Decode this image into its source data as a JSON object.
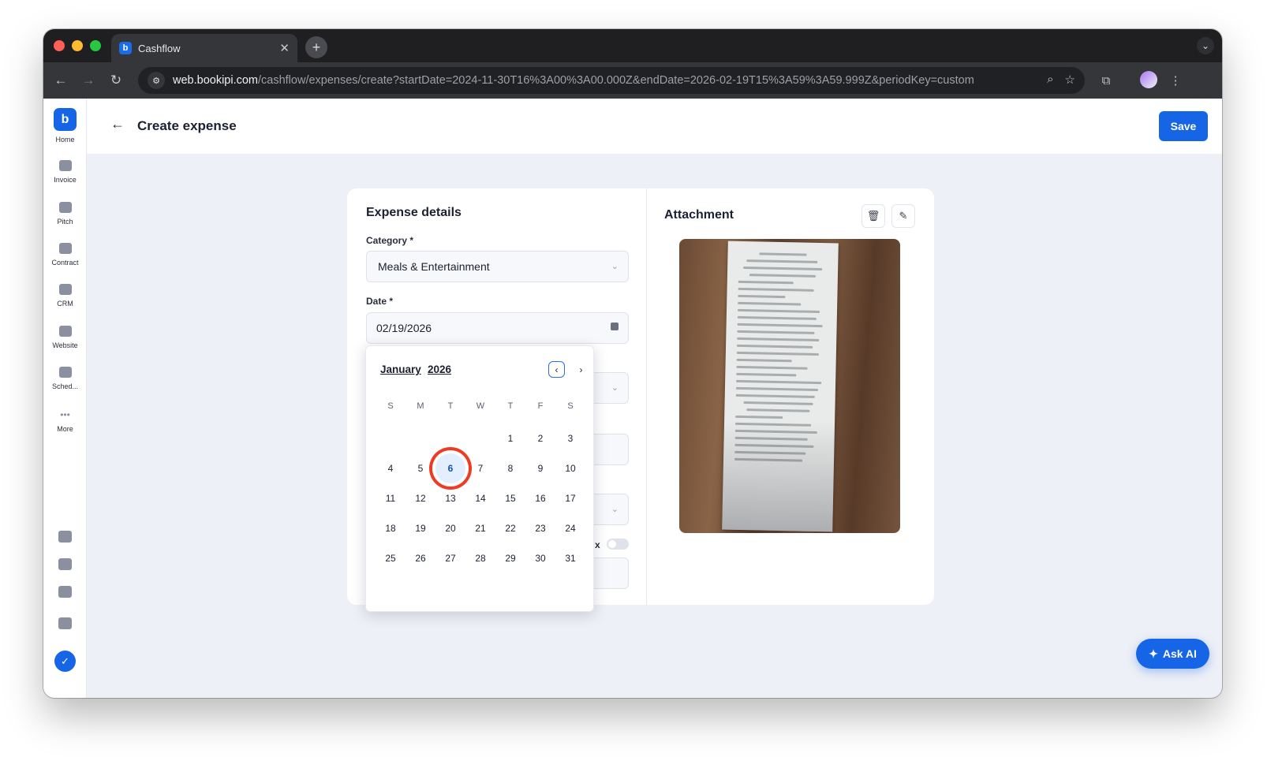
{
  "browser": {
    "tab_title": "Cashflow",
    "tab_favicon": "b",
    "url_host": "web.bookipi.com",
    "url_path": "/cashflow/expenses/create?startDate=2024-11-30T16%3A00%3A00.000Z&endDate=2026-02-19T15%3A59%3A59.999Z&periodKey=custom"
  },
  "sidebar": {
    "items": [
      {
        "label": "Home",
        "icon": "bookipi-logo-icon"
      },
      {
        "label": "Invoice",
        "icon": "invoice-icon"
      },
      {
        "label": "Pitch",
        "icon": "pitch-icon"
      },
      {
        "label": "Contract",
        "icon": "contract-icon"
      },
      {
        "label": "CRM",
        "icon": "crm-icon"
      },
      {
        "label": "Website",
        "icon": "website-icon"
      },
      {
        "label": "Sched...",
        "icon": "schedule-icon"
      },
      {
        "label": "More",
        "icon": "more-icon"
      }
    ]
  },
  "header": {
    "title": "Create expense",
    "save_label": "Save"
  },
  "expense": {
    "section_title": "Expense details",
    "category_label": "Category *",
    "category_value": "Meals & Entertainment",
    "date_label": "Date *",
    "date_value": "02/19/2026",
    "toggle_label_fragment": "x"
  },
  "calendar": {
    "month": "January",
    "year": "2026",
    "weekdays": [
      "S",
      "M",
      "T",
      "W",
      "T",
      "F",
      "S"
    ],
    "first_weekday_index": 4,
    "days_in_month": 31,
    "selected_day": 6
  },
  "attachment": {
    "title": "Attachment"
  },
  "ask_ai": {
    "label": "Ask AI"
  },
  "colors": {
    "primary": "#1565e6",
    "highlight_ring": "#ee3b24",
    "app_background": "#eef0f7"
  }
}
